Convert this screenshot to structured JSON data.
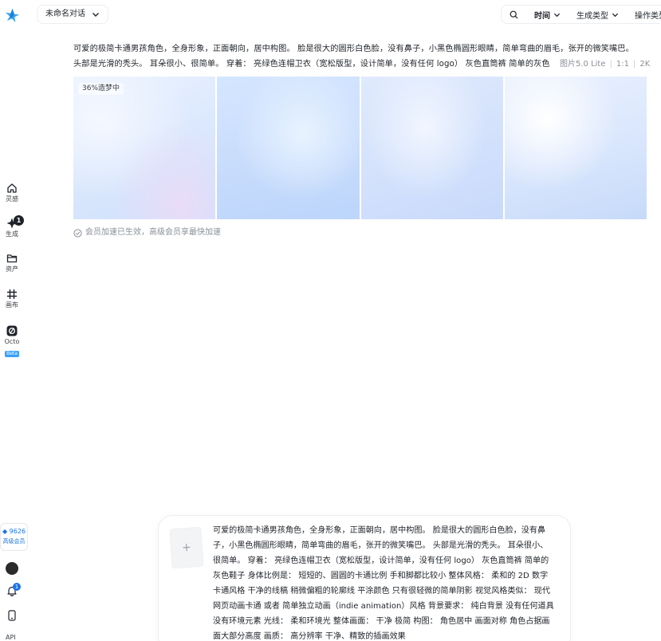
{
  "nav": {
    "items": [
      {
        "key": "inspiration",
        "label": "灵感",
        "icon": "home-icon"
      },
      {
        "key": "generate",
        "label": "生成",
        "icon": "sparkle-icon",
        "badge": "1"
      },
      {
        "key": "assets",
        "label": "资产",
        "icon": "folder-icon"
      },
      {
        "key": "canvas",
        "label": "画布",
        "icon": "grid-icon"
      },
      {
        "key": "octo",
        "label": "Octo",
        "icon": "octo-icon",
        "tag": "Beta"
      }
    ],
    "credits": "9626",
    "membership": "高级会员",
    "notifications_badge": "1",
    "api_label": "API"
  },
  "header": {
    "conversation_title": "未命名对话",
    "toolbar": {
      "time_label": "时间",
      "gen_type_label": "生成类型",
      "op_type_label": "操作类型"
    }
  },
  "task": {
    "prompt_line1": "可爱的极简卡通男孩角色，全身形象，正面朝向，居中构图。 脸是很大的圆形白色脸，没有鼻子，小黑色椭圆形眼睛，简单弯曲的眉毛，张开的微笑嘴巴。",
    "prompt_line2": "头部是光滑的秃头。 耳朵很小、很简单。 穿着： 亮绿色连帽卫衣（宽松版型，设计简单，没有任何 logo） 灰色直筒裤 简单的灰色",
    "model": "图片5.0 Lite",
    "ratio": "1:1",
    "resolution": "2K",
    "progress_label": "36%造梦中",
    "progress": 0.36,
    "vip_note": "会员加速已生效，高级会员享最快加速"
  },
  "composer": {
    "text": "可爱的极简卡通男孩角色，全身形象，正面朝向，居中构图。 脸是很大的圆形白色脸，没有鼻\n子，小黑色椭圆形眼睛，简单弯曲的眉毛，张开的微笑嘴巴。 头部是光滑的秃头。 耳朵很小、\n很简单。 穿着： 亮绿色连帽卫衣（宽松版型，设计简单，没有任何 logo） 灰色直筒裤 简单的\n灰色鞋子 身体比例是： 短短的、圆圆的卡通比例 手和脚都比较小 整体风格： 柔和的 2D 数字\n卡通风格 干净的线稿 稍微偏粗的轮廓线 平涂颜色 只有很轻微的简单阴影 视觉风格类似： 现代\n网页动画卡通 或者 简单独立动画（indie animation）风格 背景要求： 纯白背景 没有任何道具\n没有环境元素 光线： 柔和环境光 整体画面： 干净 极简 构图： 角色居中 画面对称 角色占据画\n面大部分高度 画质： 高分辨率 干净、精致的插画效果",
    "add_symbol": "+"
  }
}
